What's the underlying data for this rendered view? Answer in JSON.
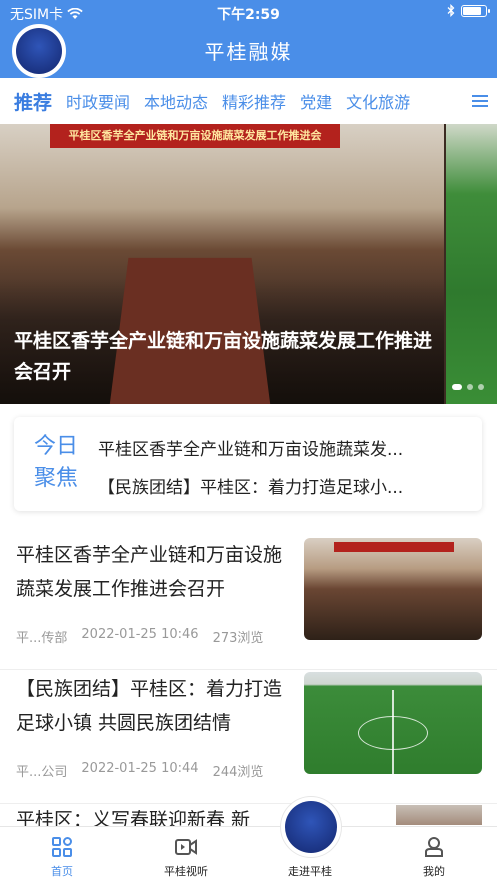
{
  "status": {
    "carrier": "无SIM卡",
    "time": "下午2:59"
  },
  "header": {
    "title": "平桂融媒"
  },
  "tabs": [
    "推荐",
    "时政要闻",
    "本地动态",
    "精彩推荐",
    "党建",
    "文化旅游"
  ],
  "banner": {
    "caption": "平桂区香芋全产业链和万亩设施蔬菜发展工作推进会召开",
    "sign": "平桂区香芋全产业链和万亩设施蔬菜发展工作推进会"
  },
  "focus": {
    "label": "今日聚焦",
    "items": [
      "平桂区香芋全产业链和万亩设施蔬菜发...",
      "【民族团结】平桂区：着力打造足球小..."
    ]
  },
  "articles": [
    {
      "title": "平桂区香芋全产业链和万亩设施蔬菜发展工作推进会召开",
      "source": "平...传部",
      "date": "2022-01-25 10:46",
      "views": "273浏览"
    },
    {
      "title": "【民族团结】平桂区：着力打造足球小镇 共圆民族团结情",
      "source": "平...公司",
      "date": "2022-01-25 10:44",
      "views": "244浏览"
    }
  ],
  "peek_title": "平桂区：义写春联迎新春 新",
  "bottom_nav": {
    "home": "首页",
    "video": "平桂视听",
    "explore": "走进平桂",
    "mine": "我的"
  },
  "colors": {
    "primary": "#4a8ee8",
    "focus_text": "#222222",
    "meta": "#999999"
  }
}
